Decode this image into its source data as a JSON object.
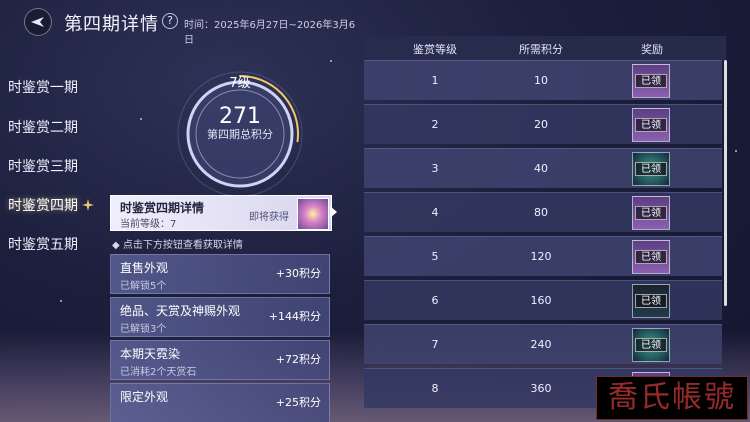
{
  "header": {
    "title": "第四期详情",
    "help_glyph": "?",
    "time": "时间：2025年6月27日~2026年3月6日"
  },
  "sidebar": {
    "items": [
      {
        "label": "时鉴赏一期"
      },
      {
        "label": "时鉴赏二期"
      },
      {
        "label": "时鉴赏三期"
      },
      {
        "label": "时鉴赏四期",
        "active": true
      },
      {
        "label": "时鉴赏五期"
      }
    ]
  },
  "ring": {
    "level": "7级",
    "score": "271",
    "label": "第四期总积分",
    "progress_fraction": 0.27
  },
  "detail_card": {
    "title": "时鉴赏四期详情",
    "current_level": "当前等级：7",
    "upcoming": "即将获得"
  },
  "hint": "◆ 点击下方按钮查看获取详情",
  "sources": [
    {
      "name": "直售外观",
      "sub": "已解锁5个",
      "points": "+30积分"
    },
    {
      "name": "绝品、天赏及神赐外观",
      "sub": "已解锁3个",
      "points": "+144积分"
    },
    {
      "name": "本期天霓染",
      "sub": "已消耗2个天赏石",
      "points": "+72积分"
    },
    {
      "name": "限定外观",
      "sub": "",
      "points": "+25积分"
    }
  ],
  "table": {
    "headers": [
      "鉴赏等级",
      "所需积分",
      "奖励"
    ],
    "rows": [
      {
        "level": "1",
        "points": "10",
        "reward": "已领",
        "style": "purple"
      },
      {
        "level": "2",
        "points": "20",
        "reward": "已领",
        "style": "purple"
      },
      {
        "level": "3",
        "points": "40",
        "reward": "已领",
        "style": "green"
      },
      {
        "level": "4",
        "points": "80",
        "reward": "已领",
        "style": "purple"
      },
      {
        "level": "5",
        "points": "120",
        "reward": "已领",
        "style": "purple"
      },
      {
        "level": "6",
        "points": "160",
        "reward": "已领",
        "style": "dark"
      },
      {
        "level": "7",
        "points": "240",
        "reward": "已领",
        "style": "green"
      },
      {
        "level": "8",
        "points": "360",
        "reward": "",
        "style": "purple"
      }
    ]
  },
  "watermark": "喬氏帳號",
  "colors": {
    "background": "#1c1f3c",
    "accent_gold": "#f2c86a",
    "card_light": "#f0eefc",
    "watermark_red": "#9a2a2a"
  },
  "icons": [
    "back-arrow-icon",
    "diamond-help-icon",
    "star-icon"
  ]
}
